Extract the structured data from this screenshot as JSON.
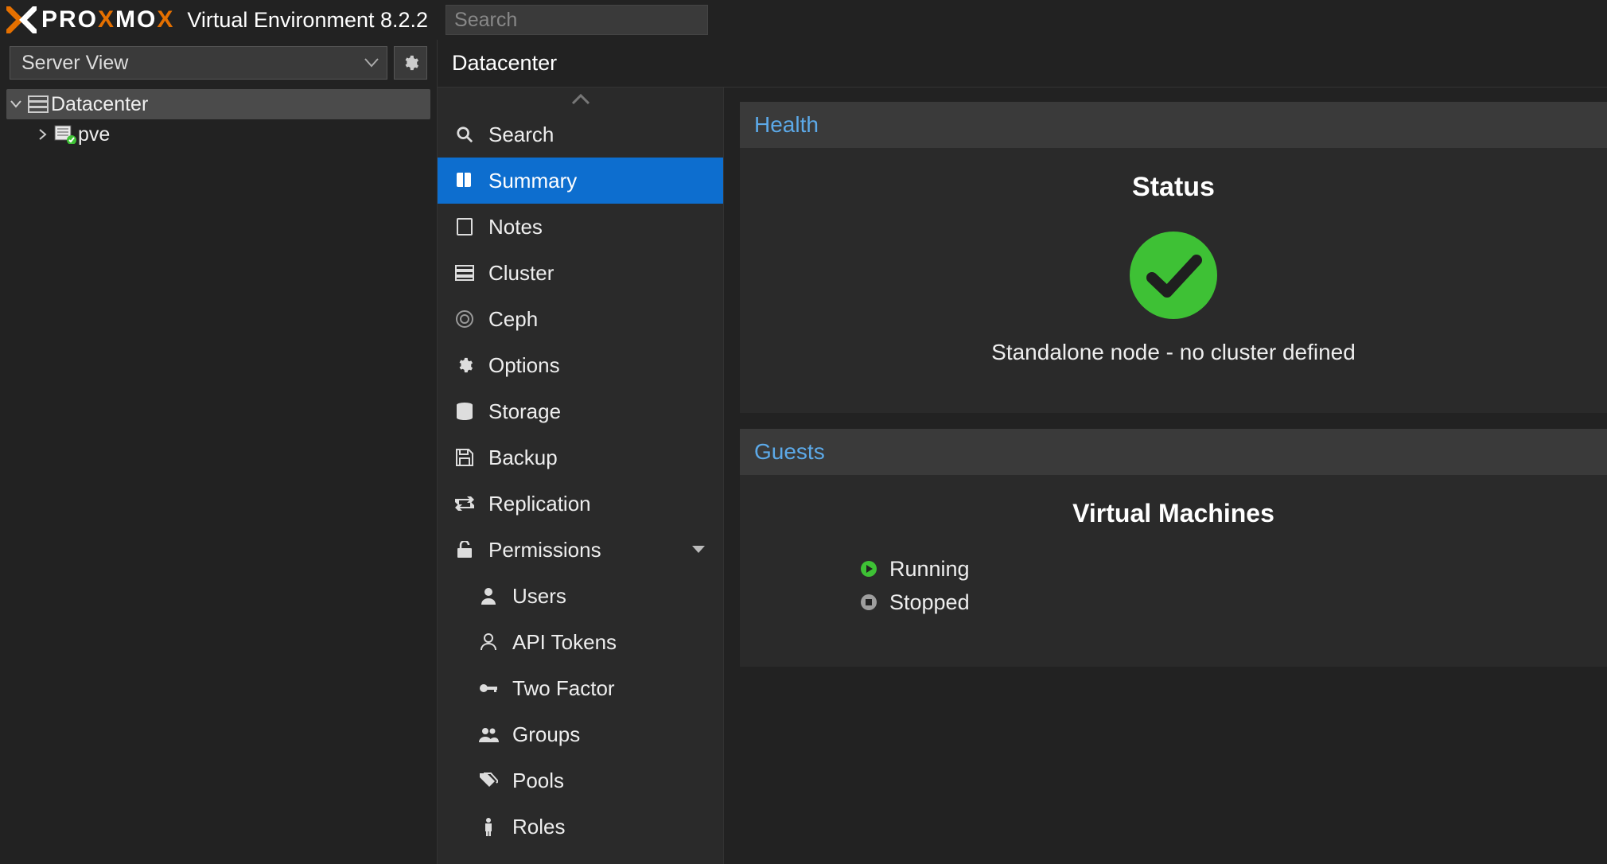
{
  "header": {
    "product_label": "Virtual Environment 8.2.2",
    "search_placeholder": "Search"
  },
  "sidebar": {
    "view_label": "Server View",
    "tree": {
      "root": {
        "label": "Datacenter"
      },
      "children": [
        {
          "label": "pve"
        }
      ]
    }
  },
  "breadcrumb": {
    "title": "Datacenter"
  },
  "nav": {
    "items": [
      {
        "id": "search",
        "label": "Search",
        "icon": "search-icon"
      },
      {
        "id": "summary",
        "label": "Summary",
        "icon": "book-icon",
        "active": true
      },
      {
        "id": "notes",
        "label": "Notes",
        "icon": "note-icon"
      },
      {
        "id": "cluster",
        "label": "Cluster",
        "icon": "server-icon"
      },
      {
        "id": "ceph",
        "label": "Ceph",
        "icon": "ceph-icon"
      },
      {
        "id": "options",
        "label": "Options",
        "icon": "gear-icon"
      },
      {
        "id": "storage",
        "label": "Storage",
        "icon": "database-icon"
      },
      {
        "id": "backup",
        "label": "Backup",
        "icon": "save-icon"
      },
      {
        "id": "replication",
        "label": "Replication",
        "icon": "retweet-icon"
      },
      {
        "id": "permissions",
        "label": "Permissions",
        "icon": "unlock-icon",
        "expandable": true
      }
    ],
    "sub_items": [
      {
        "id": "users",
        "label": "Users",
        "icon": "user-icon"
      },
      {
        "id": "apitokens",
        "label": "API Tokens",
        "icon": "user-o-icon"
      },
      {
        "id": "twofactor",
        "label": "Two Factor",
        "icon": "key-icon"
      },
      {
        "id": "groups",
        "label": "Groups",
        "icon": "users-icon"
      },
      {
        "id": "pools",
        "label": "Pools",
        "icon": "tags-icon"
      },
      {
        "id": "roles",
        "label": "Roles",
        "icon": "male-icon"
      }
    ]
  },
  "panels": {
    "health": {
      "title": "Health",
      "status_heading": "Status",
      "status_message": "Standalone node - no cluster defined"
    },
    "guests": {
      "title": "Guests",
      "vm_heading": "Virtual Machines",
      "rows": [
        {
          "label": "Running",
          "icon": "play-icon",
          "color": "#3ec135"
        },
        {
          "label": "Stopped",
          "icon": "stop-icon",
          "color": "#9e9e9e"
        }
      ]
    }
  },
  "colors": {
    "accent_blue": "#0d6ecf",
    "link_blue": "#5ca9e8",
    "brand_orange": "#e57000",
    "status_green": "#3ec135"
  }
}
